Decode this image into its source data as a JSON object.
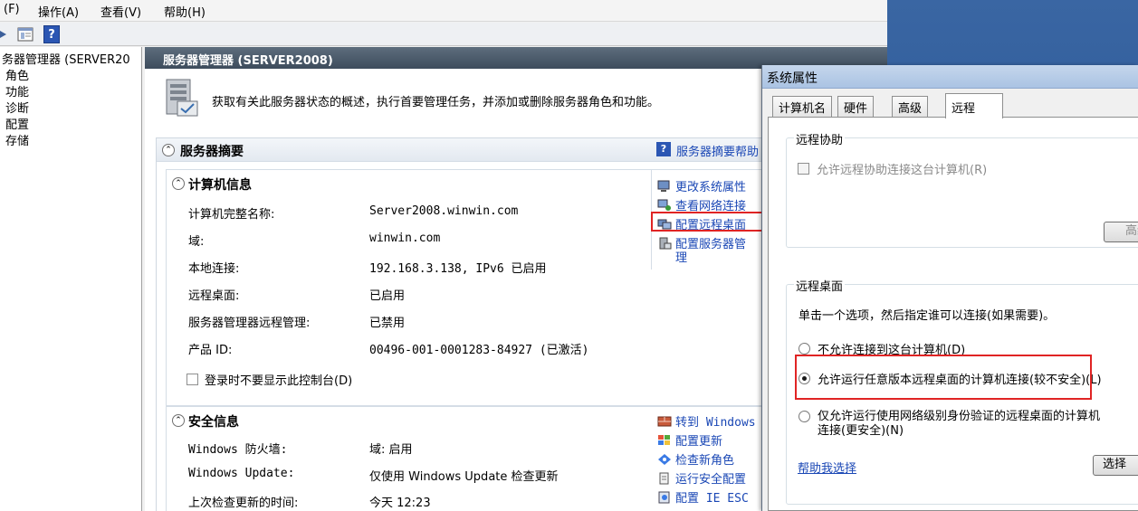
{
  "menubar": {
    "items": [
      "(F)",
      "操作(A)",
      "查看(V)",
      "帮助(H)"
    ]
  },
  "toolbar": {
    "icons": [
      "nav-forward-icon",
      "show-tree-icon",
      "help-icon"
    ],
    "help_glyph": "?"
  },
  "tree": {
    "root": "务器管理器 (SERVER20",
    "items": [
      "角色",
      "功能",
      "诊断",
      "配置",
      "存储"
    ]
  },
  "content": {
    "header_title": "服务器管理器 (SERVER2008)",
    "intro_text": "获取有关此服务器状态的概述，执行首要管理任务，并添加或删除服务器角色和功能。",
    "summary": {
      "title": "服务器摘要",
      "help_link": "服务器摘要帮助"
    },
    "computer_info": {
      "title": "计算机信息",
      "rows": [
        {
          "label": "计算机完整名称:",
          "value": "Server2008.winwin.com"
        },
        {
          "label": "域:",
          "value": "winwin.com"
        },
        {
          "label": "本地连接:",
          "value": "192.168.3.138, IPv6 已启用"
        },
        {
          "label": "远程桌面:",
          "value": "已启用"
        },
        {
          "label": "服务器管理器远程管理:",
          "value": "已禁用"
        },
        {
          "label": "产品 ID:",
          "value": "00496-001-0001283-84927 (已激活)"
        }
      ],
      "checkbox_label": "登录时不要显示此控制台(D)",
      "links": [
        "更改系统属性",
        "查看网络连接",
        "配置远程桌面",
        "配置服务器管",
        "理"
      ]
    },
    "security_info": {
      "title": "安全信息",
      "rows": [
        {
          "label": "Windows 防火墙:",
          "value": "域: 启用"
        },
        {
          "label": "Windows Update:",
          "value": "仅使用 Windows Update 检查更新"
        },
        {
          "label": "上次检查更新的时间:",
          "value": "今天 12:23"
        }
      ],
      "links": [
        "转到 Windows",
        "配置更新",
        "检查新角色",
        "运行安全配置",
        "配置 IE ESC"
      ]
    }
  },
  "dialog": {
    "title": "系统属性",
    "tabs": [
      "计算机名",
      "硬件",
      "高级",
      "远程"
    ],
    "active_tab": "远程",
    "remote_assistance": {
      "group_label": "远程协助",
      "checkbox_label": "允许远程协助连接这台计算机(R)",
      "advanced_button": "高级"
    },
    "remote_desktop": {
      "group_label": "远程桌面",
      "instruction": "单击一个选项，然后指定谁可以连接(如果需要)。",
      "options": [
        {
          "label": "不允许连接到这台计算机(D)",
          "checked": false
        },
        {
          "label": "允许运行任意版本远程桌面的计算机连接(较不安全)(L)",
          "checked": true
        },
        {
          "label": "仅允许运行使用网络级别身份验证的远程桌面的计算机",
          "label2": "连接(更安全)(N)",
          "checked": false
        }
      ],
      "help_link": "帮助我选择",
      "select_button": "选择"
    }
  },
  "colors": {
    "highlight": "#e02424",
    "link": "#1a47b5",
    "header": "#4a5968"
  }
}
